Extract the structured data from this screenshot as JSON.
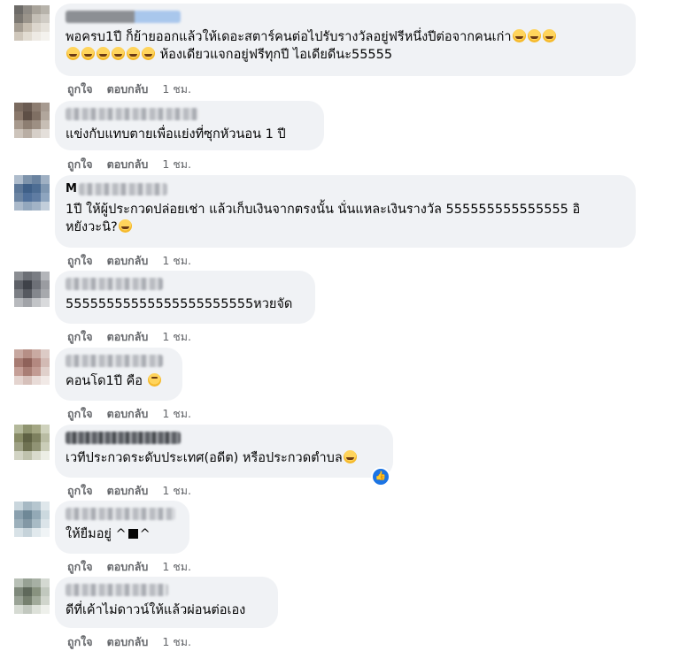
{
  "actions": {
    "like": "ถูกใจ",
    "reply": "ตอบกลับ",
    "time": "1 ชม."
  },
  "comments": [
    {
      "name_visible": "",
      "text_parts": [
        "พอครบ1ปี ก็ย้ายออกแล้วให้เดอะสตาร์คนต่อไปรับรางวัลอยู่ฟรีหนึ่งปีต่อจากคนเก่า",
        " ห้องเดียวแจกอยู่ฟรีทุกปี ไอเดียดีนะ55555"
      ],
      "emoji_icon": "rofl-emoji"
    },
    {
      "name_visible": "",
      "text": "แข่งกับแทบตายเพื่อแย่งที่ซุกหัวนอน 1 ปี"
    },
    {
      "name_visible": "M",
      "text_line1": "1ปี ให้ผู้ประกวดปล่อยเช่า แล้วเก็บเงินจากตรงนั้น นั่นแหละเงินรางวัล 555555555555555 อิ",
      "text_line2": "หยังวะนิ?",
      "emoji_icon": "rofl-emoji"
    },
    {
      "name_visible": "",
      "text": "55555555555555555555555หวยจัด"
    },
    {
      "name_visible": "",
      "text": "คอนโด1ปี คือ",
      "emoji_icon": "rolling-eyes-emoji"
    },
    {
      "name_visible": "",
      "text": "เวทีประกวดระดับประเทศ(อดีต) หรือประกวดตำบล",
      "emoji_icon": "laughing-emoji",
      "reaction_icon": "like-reaction-icon"
    },
    {
      "name_visible": "",
      "text_before": "ให้ยืมอยู่ ^",
      "text_after": "^"
    },
    {
      "name_visible": "",
      "text": "ดีที่เค้าไม่ดาวน์ให้แล้วผ่อนต่อเอง"
    }
  ],
  "colors": {
    "bubble": "#f0f2f5",
    "meta": "#65676b",
    "like_blue": "#1b74e4"
  }
}
